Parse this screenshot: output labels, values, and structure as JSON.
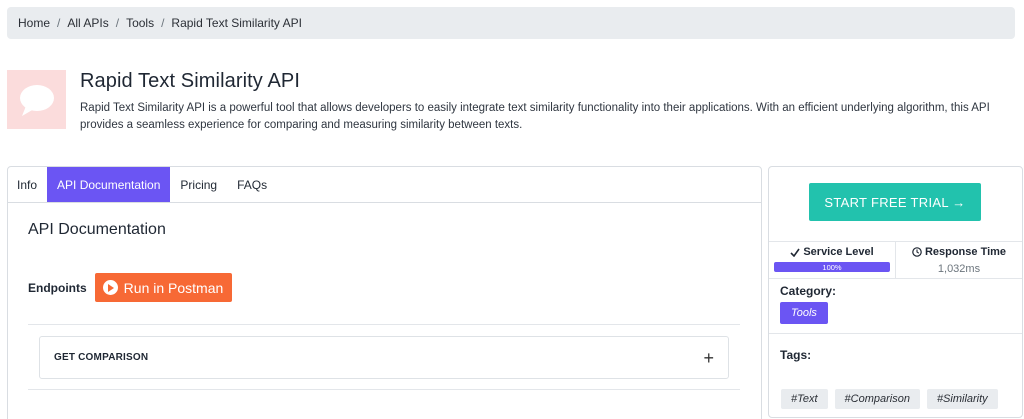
{
  "breadcrumb": {
    "items": [
      "Home",
      "All APIs",
      "Tools",
      "Rapid Text Similarity API"
    ],
    "separator": "/"
  },
  "header": {
    "title": "Rapid Text Similarity API",
    "description": "Rapid Text Similarity API is a powerful tool that allows developers to easily integrate text similarity functionality into their applications. With an efficient underlying algorithm, this API provides a seamless experience for comparing and measuring similarity between texts.",
    "logo_icon": "speech-bubble-icon"
  },
  "tabs": [
    {
      "label": "Info",
      "active": false
    },
    {
      "label": "API Documentation",
      "active": true
    },
    {
      "label": "Pricing",
      "active": false
    },
    {
      "label": "FAQs",
      "active": false
    }
  ],
  "documentation": {
    "heading": "API Documentation",
    "endpoints_label": "Endpoints",
    "postman_button": "Run in Postman",
    "endpoints": [
      {
        "name": "GET COMPARISON",
        "expand_icon": "+"
      }
    ]
  },
  "sidebar": {
    "trial_button": "START FREE TRIAL →",
    "service_level": {
      "label": "Service Level",
      "value": "100%",
      "fraction": 1.0
    },
    "response_time": {
      "label": "Response Time",
      "value": "1,032ms"
    },
    "category_label": "Category:",
    "category": "Tools",
    "tags_label": "Tags:",
    "tags": [
      "#Text",
      "#Comparison",
      "#Similarity"
    ]
  },
  "colors": {
    "accent": "#6b55f3",
    "trial": "#22c2ad",
    "postman": "#f76935",
    "logo_bg": "#fbdcdc"
  }
}
